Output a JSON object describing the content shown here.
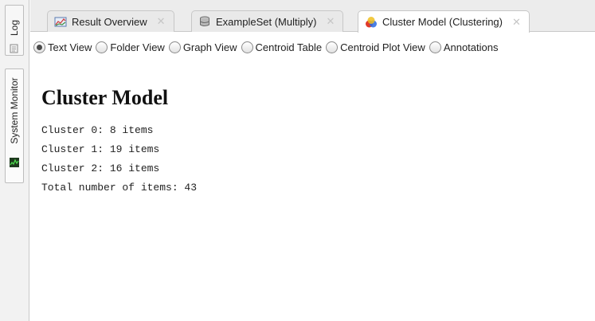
{
  "side_panel": {
    "log_label": "Log",
    "system_monitor_label": "System Monitor",
    "icons": [
      "log-icon",
      "system-monitor-icon"
    ]
  },
  "tabs": [
    {
      "label": "Result Overview",
      "icon": "result-overview-icon",
      "active": false
    },
    {
      "label": "ExampleSet (Multiply)",
      "icon": "exampleset-icon",
      "active": false
    },
    {
      "label": "Cluster Model (Clustering)",
      "icon": "cluster-model-icon",
      "active": true
    }
  ],
  "views": [
    {
      "label": "Text View",
      "selected": true
    },
    {
      "label": "Folder View",
      "selected": false
    },
    {
      "label": "Graph View",
      "selected": false
    },
    {
      "label": "Centroid Table",
      "selected": false
    },
    {
      "label": "Centroid Plot View",
      "selected": false
    },
    {
      "label": "Annotations",
      "selected": false
    }
  ],
  "content": {
    "heading": "Cluster Model",
    "lines": [
      "Cluster 0: 8 items",
      "Cluster 1: 19 items",
      "Cluster 2: 16 items",
      "Total number of items: 43"
    ]
  },
  "colors": {
    "background": "#ffffff",
    "chrome": "#ececec",
    "close_x": "#c6c6c6"
  }
}
